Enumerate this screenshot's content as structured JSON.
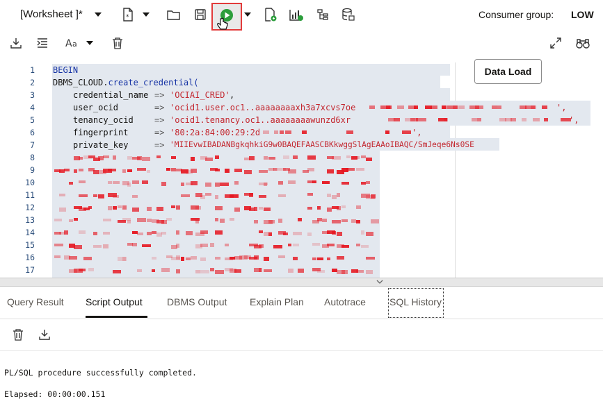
{
  "toolbar": {
    "worksheet_title": "[Worksheet ]*",
    "consumer_group_label": "Consumer group:",
    "consumer_group_value": "LOW",
    "data_load_label": "Data Load",
    "icons": [
      "new-worksheet-icon",
      "open-icon",
      "save-icon",
      "run-script-icon",
      "explain-icon",
      "autotrace-icon",
      "tree-icon",
      "database-icon",
      "download-icon",
      "format-icon",
      "font-case-icon",
      "trash-icon",
      "expand-icon",
      "binoculars-icon"
    ]
  },
  "editor": {
    "line_numbers": [
      "1",
      "2",
      "3",
      "4",
      "5",
      "6",
      "7",
      "8",
      "9",
      "10",
      "11",
      "12",
      "13",
      "14",
      "15",
      "16",
      "17"
    ],
    "lines": {
      "l1": "BEGIN",
      "l2_obj": "DBMS_CLOUD.",
      "l2_fn": "create_credential(",
      "l3_key": "credential_name",
      "l3_val": "'OCIAI_CRED'",
      "l4_key": "user_ocid",
      "l4_val": "'ocid1.user.oc1..aaaaaaaaxh3a7xcvs7oe",
      "l4_end": "',",
      "l5_key": "tenancy_ocid",
      "l5_val": "'ocid1.tenancy.oc1..aaaaaaaawunzd6xr",
      "l5_end": "',",
      "l6_key": "fingerprint",
      "l6_val": "'80:2a:84:00:29:2d",
      "l6_end": "',",
      "l7_key": "private_key",
      "l7_val": "'MIIEvwIBADANBgkqhkiG9w0BAQEFAASCBKkwggSlAgEAAoIBAQC/SmJeqe6Ns0SE",
      "arrow": "=>",
      "comma": ","
    }
  },
  "tabs": [
    "Query Result",
    "Script Output",
    "DBMS Output",
    "Explain Plan",
    "Autotrace",
    "SQL History"
  ],
  "active_tab": "Script Output",
  "output": {
    "line1": "PL/SQL procedure successfully completed.",
    "line2": "Elapsed: 00:00:00.151"
  },
  "colors": {
    "run_green": "#2c9e3c",
    "highlight_red": "#e23b3b",
    "string_red": "#c3262e",
    "keyword_blue": "#1633a5"
  }
}
